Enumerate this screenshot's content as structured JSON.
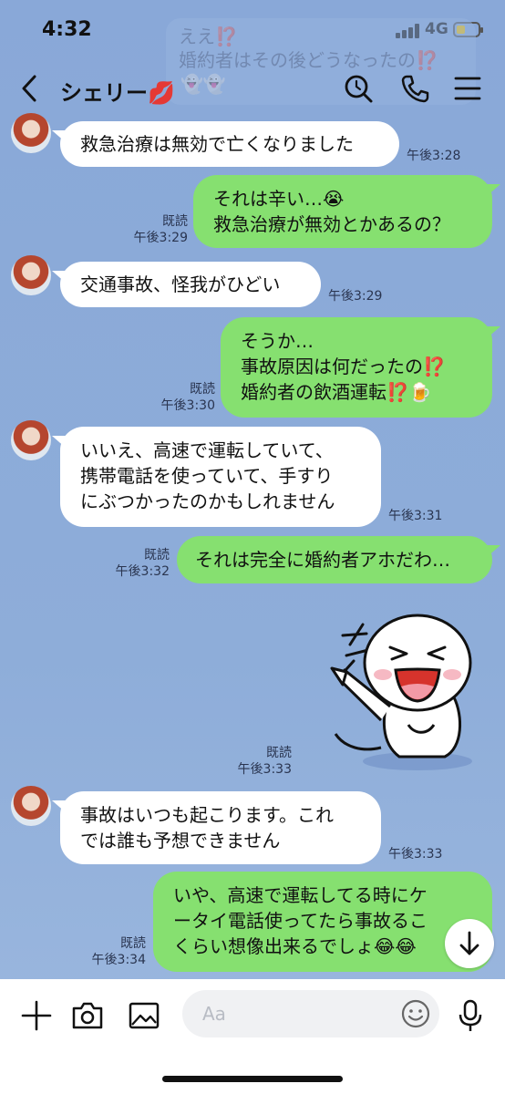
{
  "status_bar": {
    "time": "4:32",
    "network": "4G"
  },
  "overlay_notification": {
    "line1": "ええ⁉️",
    "line2": "婚約者はその後どうなったの⁉️"
  },
  "header": {
    "title": "シェリー",
    "title_emoji": "💋",
    "ghost_emoji": "👻👻"
  },
  "messages": [
    {
      "side": "left",
      "lines": [
        "救急治療は無効で亡くなりました"
      ],
      "time": "午後3:28"
    },
    {
      "side": "right",
      "lines": [
        "それは辛い…😭",
        "救急治療が無効とかあるの？"
      ],
      "read": "既読",
      "time": "午後3:29"
    },
    {
      "side": "left",
      "lines": [
        "交通事故、怪我がひどい"
      ],
      "time": "午後3:29"
    },
    {
      "side": "right",
      "lines": [
        "そうか…",
        "事故原因は何だったの⁉️",
        "婚約者の飲酒運転⁉️🍺"
      ],
      "read": "既読",
      "time": "午後3:30"
    },
    {
      "side": "left",
      "lines": [
        "いいえ、高速で運転していて、",
        "携帯電話を使っていて、手すり",
        "にぶつかったのかもしれません"
      ],
      "time": "午後3:31"
    },
    {
      "side": "right",
      "lines": [
        "それは完全に婚約者アホだわ…"
      ],
      "read": "既読",
      "time": "午後3:32"
    },
    {
      "side": "right",
      "sticker": "laughing-sticker",
      "read": "既読",
      "time": "午後3:33"
    },
    {
      "side": "left",
      "lines": [
        "事故はいつも起こります。これ",
        "では誰も予想できません"
      ],
      "time": "午後3:33"
    },
    {
      "side": "right",
      "lines": [
        "いや、高速で運転してる時にケ",
        "ータイ電話使ってたら事故るこ",
        "くらい想像出来るでしょ😂😂"
      ],
      "read": "既読",
      "time": "午後3:34"
    }
  ],
  "input": {
    "placeholder": "Aa"
  },
  "colors": {
    "background": "#8aa9d8",
    "sent_bubble": "#86e070",
    "received_bubble": "#ffffff"
  },
  "icons": [
    "back-icon",
    "search-icon",
    "phone-icon",
    "menu-icon",
    "plus-icon",
    "camera-icon",
    "image-icon",
    "emoji-icon",
    "microphone-icon",
    "arrow-down-icon"
  ]
}
